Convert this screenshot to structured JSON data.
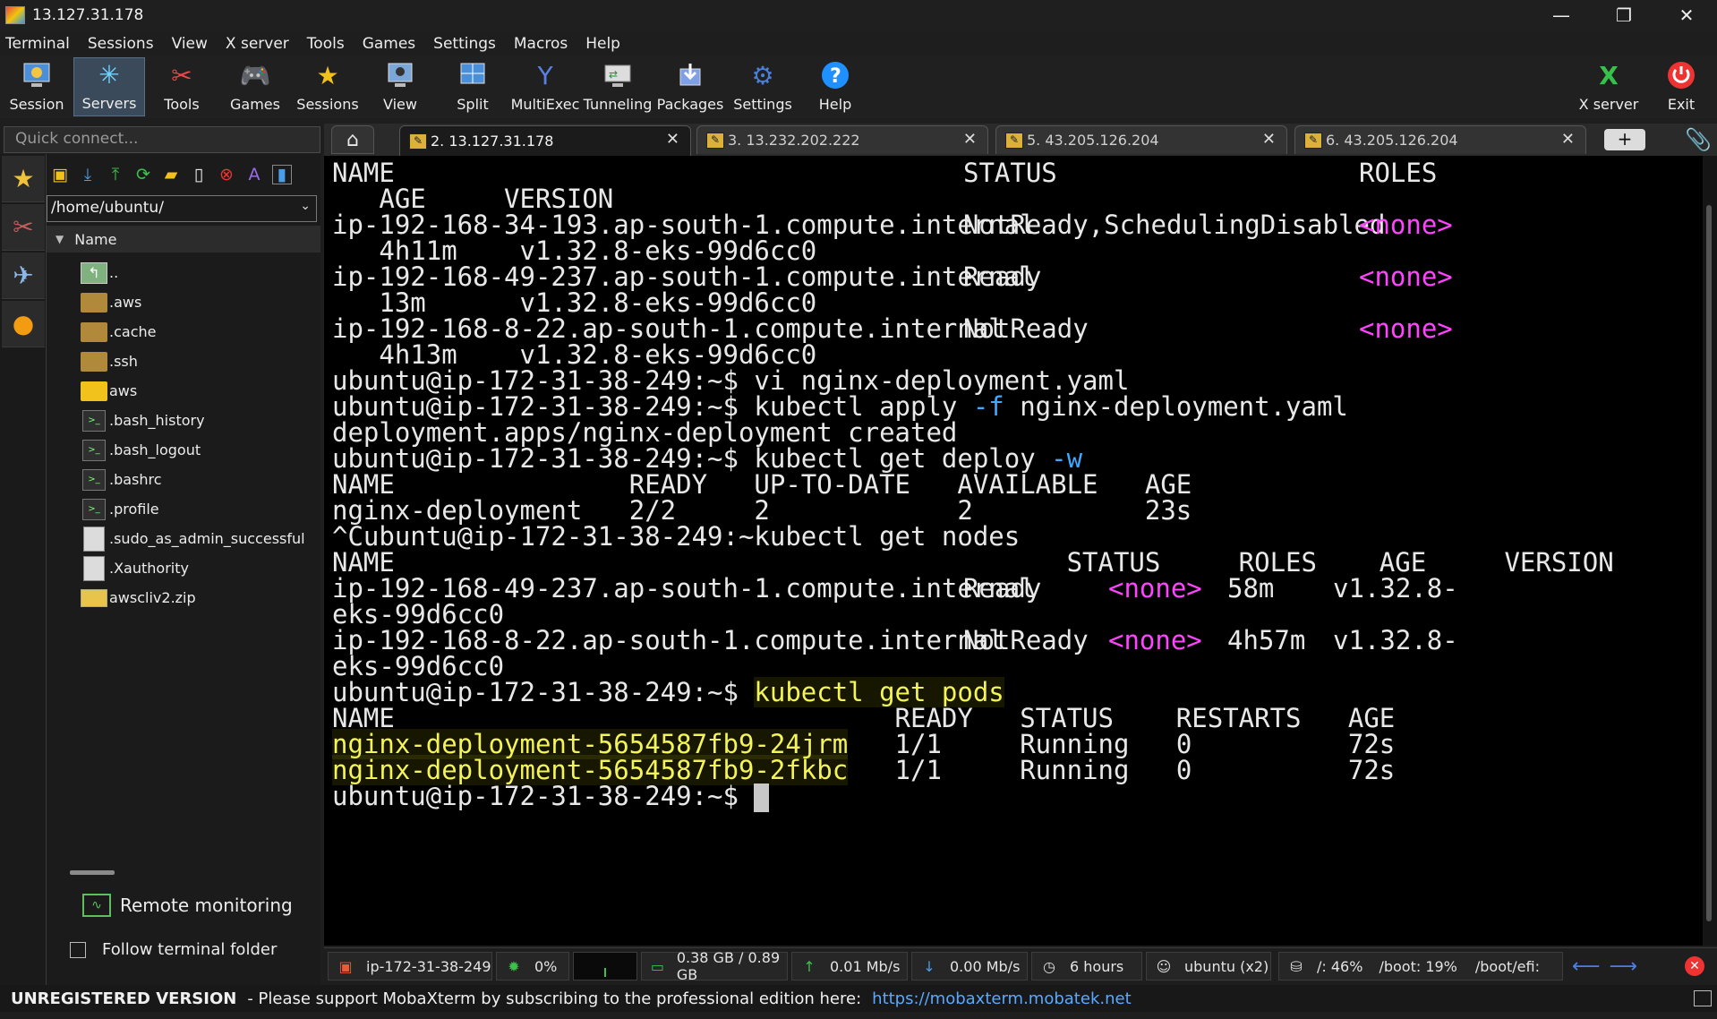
{
  "window": {
    "title": "13.127.31.178",
    "minimize": "—",
    "restore": "❐",
    "close": "✕"
  },
  "menu": [
    "Terminal",
    "Sessions",
    "View",
    "X server",
    "Tools",
    "Games",
    "Settings",
    "Macros",
    "Help"
  ],
  "toolbar": {
    "session": "Session",
    "servers": "Servers",
    "tools": "Tools",
    "games": "Games",
    "sessions": "Sessions",
    "view": "View",
    "split": "Split",
    "multiexec": "MultiExec",
    "tunneling": "Tunneling",
    "packages": "Packages",
    "settings": "Settings",
    "help": "Help",
    "xserver": "X server",
    "exit": "Exit"
  },
  "quick_connect": {
    "placeholder": "Quick connect..."
  },
  "tabs": [
    {
      "label": "2. 13.127.31.178",
      "active": true
    },
    {
      "label": "3. 13.232.202.222"
    },
    {
      "label": "5. 43.205.126.204"
    },
    {
      "label": "6. 43.205.126.204"
    }
  ],
  "filepanel": {
    "path": "/home/ubuntu/",
    "column": "Name",
    "items": [
      {
        "name": "..",
        "kind": "up"
      },
      {
        "name": ".aws",
        "kind": "folder"
      },
      {
        "name": ".cache",
        "kind": "folder"
      },
      {
        "name": ".ssh",
        "kind": "folder"
      },
      {
        "name": "aws",
        "kind": "folder-bright"
      },
      {
        "name": ".bash_history",
        "kind": "script"
      },
      {
        "name": ".bash_logout",
        "kind": "script"
      },
      {
        "name": ".bashrc",
        "kind": "script"
      },
      {
        "name": ".profile",
        "kind": "script"
      },
      {
        "name": ".sudo_as_admin_successful",
        "kind": "plain"
      },
      {
        "name": ".Xauthority",
        "kind": "plain"
      },
      {
        "name": "awscliv2.zip",
        "kind": "zip"
      }
    ],
    "remote_monitoring": "Remote monitoring",
    "follow_folder": "Follow terminal folder"
  },
  "terminal": {
    "l1_name": "NAME",
    "l1_status": "STATUS",
    "l1_roles": "ROLES",
    "l2": "   AGE     VERSION",
    "n1_name": "ip-192-168-34-193.ap-south-1.compute.internal",
    "n1_status": "NotReady,SchedulingDisabled",
    "n1_roles": "<none>",
    "n1_age": "   4h11m    v1.32.8-eks-99d6cc0",
    "n2_name": "ip-192-168-49-237.ap-south-1.compute.internal",
    "n2_status": "Ready",
    "n2_roles": "<none>",
    "n2_age": "   13m      v1.32.8-eks-99d6cc0",
    "n3_name": "ip-192-168-8-22.ap-south-1.compute.internal",
    "n3_status": "NotReady",
    "n3_roles": "<none>",
    "n3_age": "   4h13m    v1.32.8-eks-99d6cc0",
    "prompt": "ubuntu@ip-172-31-38-249:~$ ",
    "cmd_vi": "vi nginx-deployment.yaml",
    "cmd_apply_a": "kubectl apply ",
    "cmd_apply_flag": "-f",
    "cmd_apply_b": " nginx-deployment.yaml",
    "created": "deployment.apps/nginx-deployment created",
    "cmd_get_deploy": "kubectl get deploy ",
    "cmd_get_deploy_flag": "-w",
    "dep_hdr": "NAME               READY   UP-TO-DATE   AVAILABLE   AGE",
    "dep_row": "nginx-deployment   2/2     2            2           23s",
    "ctrl_c": "^Cubuntu@ip-172-31-38-249:~kubectl get nodes",
    "nodes_hdr": "NAME                                           STATUS     ROLES    AGE     VERSION",
    "r1_name": "ip-192-168-49-237.ap-south-1.compute.internal",
    "r1_status": "Ready",
    "r1_roles": "<none>",
    "r1_age": "58m",
    "r1_ver": "v1.32.8-",
    "r1_cont": "eks-99d6cc0",
    "r2_name": "ip-192-168-8-22.ap-south-1.compute.internal",
    "r2_status": "NotReady",
    "r2_roles": "<none>",
    "r2_age": "4h57m",
    "r2_ver": "v1.32.8-",
    "r2_cont": "eks-99d6cc0",
    "cmd_get_pods": "kubectl get pods",
    "pods_hdr": "NAME                                READY   STATUS    RESTARTS   AGE",
    "p1_name": "nginx-deployment-5654587fb9-24jrm",
    "p1_rest": "   1/1     Running   0          72s",
    "p2_name": "nginx-deployment-5654587fb9-2fkbc",
    "p2_rest": "   1/1     Running   0          72s"
  },
  "statusbar": {
    "host": "ip-172-31-38-249",
    "cpu": "0%",
    "mem": "0.38 GB / 0.89 GB",
    "up": "0.01 Mb/s",
    "down": "0.00 Mb/s",
    "uptime": "6 hours",
    "users": "ubuntu (x2)",
    "disk_root": "/: 46%",
    "disk_boot": "/boot: 19%",
    "disk_efi": "/boot/efi:"
  },
  "footer": {
    "unregistered": "UNREGISTERED VERSION",
    "message": "-  Please support MobaXterm by subscribing to the professional edition here:",
    "link": "https://mobaxterm.mobatek.net"
  },
  "colors": {
    "accent": "#3da9ff",
    "magenta": "#ff44ff",
    "highlight": "#f3f35a",
    "terminal_bg": "#000000"
  }
}
